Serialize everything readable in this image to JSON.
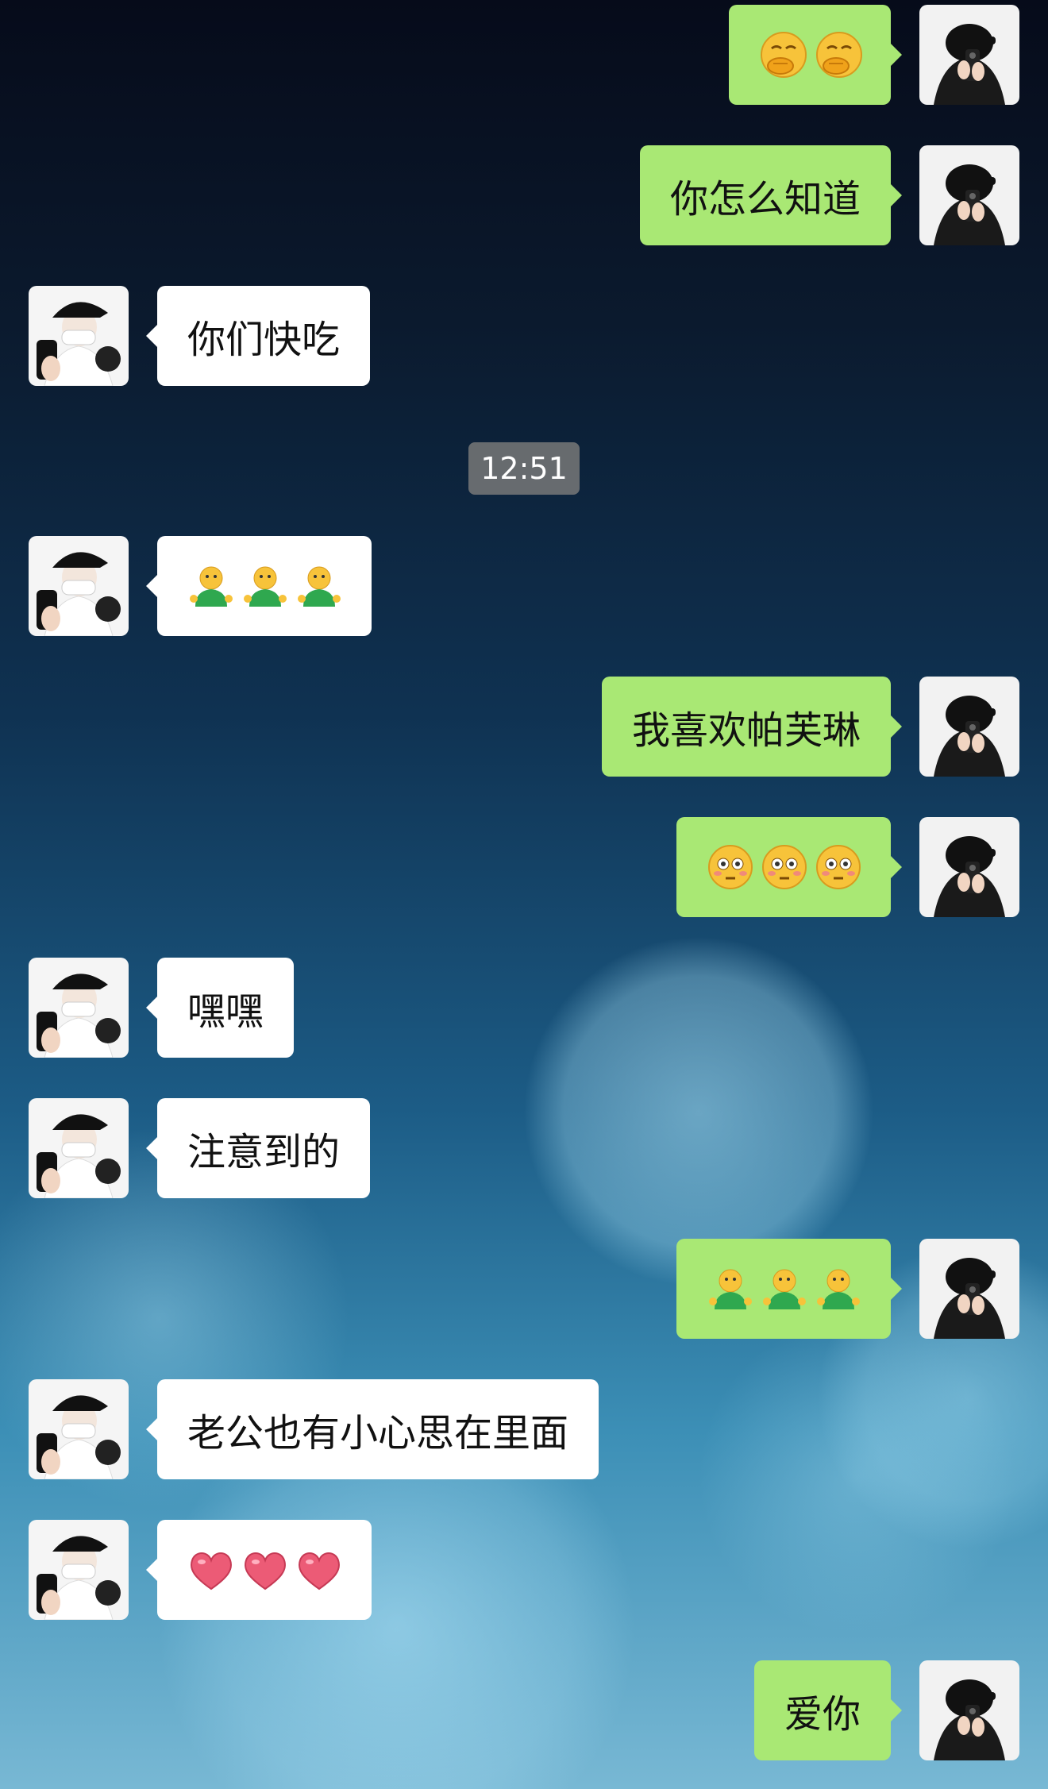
{
  "conversation": {
    "timestamp": "12:51",
    "messages": [
      {
        "side": "out",
        "type": "emoji",
        "emoji": "smirk-hand-over-mouth",
        "count": 2
      },
      {
        "side": "out",
        "type": "text",
        "text": "你怎么知道"
      },
      {
        "side": "in",
        "type": "text",
        "text": "你们快吃"
      },
      {
        "side": "in",
        "type": "emoji",
        "emoji": "green-shrug-person",
        "count": 3
      },
      {
        "side": "out",
        "type": "text",
        "text": "我喜欢帕芙琳"
      },
      {
        "side": "out",
        "type": "emoji",
        "emoji": "flushed-face",
        "count": 3
      },
      {
        "side": "in",
        "type": "text",
        "text": "嘿嘿"
      },
      {
        "side": "in",
        "type": "text",
        "text": "注意到的"
      },
      {
        "side": "out",
        "type": "emoji",
        "emoji": "green-shrug-person",
        "count": 3
      },
      {
        "side": "in",
        "type": "text",
        "text": "老公也有小心思在里面"
      },
      {
        "side": "in",
        "type": "emoji",
        "emoji": "pink-heart",
        "count": 3
      },
      {
        "side": "out",
        "type": "text",
        "text": "爱你"
      }
    ]
  },
  "colors": {
    "incoming_bubble": "#ffffff",
    "outgoing_bubble": "#a9e874",
    "timestamp_bg": "#787878"
  }
}
